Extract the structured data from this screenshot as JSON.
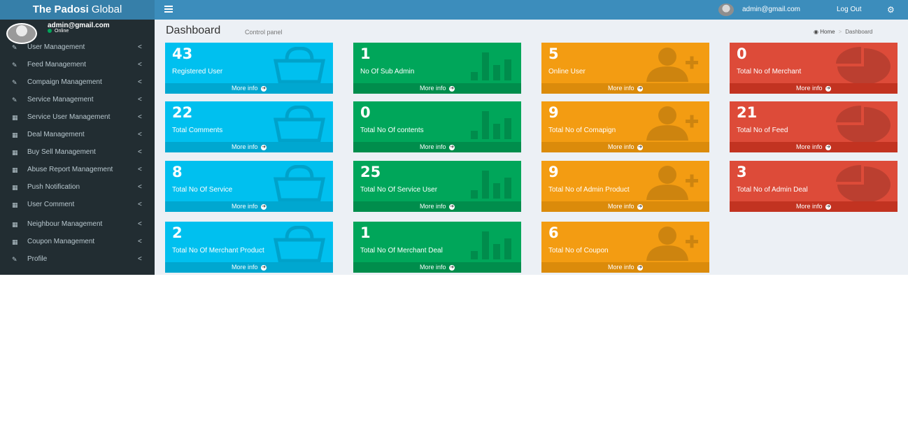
{
  "header": {
    "logo_bold": "The Padosi",
    "logo_light": " Global",
    "email": "admin@gmail.com",
    "logout": "Log Out"
  },
  "sidebar": {
    "user_email": "admin@gmail.com",
    "user_status": "Online",
    "items": [
      {
        "label": "User Management",
        "icon": "edit-icon"
      },
      {
        "label": "Feed Management",
        "icon": "edit-icon"
      },
      {
        "label": "Compaign Management",
        "icon": "edit-icon"
      },
      {
        "label": "Service Management",
        "icon": "edit-icon"
      },
      {
        "label": "Service User Management",
        "icon": "table-icon"
      },
      {
        "label": "Deal Management",
        "icon": "table-icon"
      },
      {
        "label": "Buy Sell Management",
        "icon": "table-icon"
      },
      {
        "label": "Abuse Report Management",
        "icon": "table-icon"
      },
      {
        "label": "Push Notification",
        "icon": "table-icon"
      },
      {
        "label": "User Comment",
        "icon": "table-icon"
      },
      {
        "label": "Neighbour Management",
        "icon": "table-icon"
      },
      {
        "label": "Coupon Management",
        "icon": "table-icon"
      },
      {
        "label": "Profile",
        "icon": "edit-icon"
      }
    ],
    "chevron": "<"
  },
  "content": {
    "title": "Dashboard",
    "subtitle": "Control panel",
    "breadcrumb": {
      "home": "Home",
      "sep": ">",
      "current": "Dashboard"
    }
  },
  "boxes": [
    {
      "value": "43",
      "label": "Registered User",
      "footer": "More info",
      "color": "aqua",
      "icon": "shopping-bag-icon"
    },
    {
      "value": "1",
      "label": "No Of Sub Admin",
      "footer": "More info",
      "color": "green",
      "icon": "bar-chart-icon"
    },
    {
      "value": "5",
      "label": "Online User",
      "footer": "More info",
      "color": "yellow",
      "icon": "user-add-icon"
    },
    {
      "value": "0",
      "label": "Total No of Merchant",
      "footer": "More info",
      "color": "red",
      "icon": "pie-chart-icon"
    },
    {
      "value": "22",
      "label": "Total Comments",
      "footer": "More info",
      "color": "aqua",
      "icon": "shopping-bag-icon"
    },
    {
      "value": "0",
      "label": "Total No Of contents",
      "footer": "More info",
      "color": "green",
      "icon": "bar-chart-icon"
    },
    {
      "value": "9",
      "label": "Total No of Comapign",
      "footer": "More info",
      "color": "yellow",
      "icon": "user-add-icon"
    },
    {
      "value": "21",
      "label": "Total No of Feed",
      "footer": "More info",
      "color": "red",
      "icon": "pie-chart-icon"
    },
    {
      "value": "8",
      "label": "Total No Of Service",
      "footer": "More info",
      "color": "aqua",
      "icon": "shopping-bag-icon"
    },
    {
      "value": "25",
      "label": "Total No Of Service User",
      "footer": "More info",
      "color": "green",
      "icon": "bar-chart-icon"
    },
    {
      "value": "9",
      "label": "Total No of Admin Product",
      "footer": "More info",
      "color": "yellow",
      "icon": "user-add-icon"
    },
    {
      "value": "3",
      "label": "Total No of Admin Deal",
      "footer": "More info",
      "color": "red",
      "icon": "pie-chart-icon"
    },
    {
      "value": "2",
      "label": "Total No Of Merchant Product",
      "footer": "More info",
      "color": "aqua",
      "icon": "shopping-bag-icon"
    },
    {
      "value": "1",
      "label": "Total No Of Merchant Deal",
      "footer": "More info",
      "color": "green",
      "icon": "bar-chart-icon"
    },
    {
      "value": "6",
      "label": "Total No of Coupon",
      "footer": "More info",
      "color": "yellow",
      "icon": "user-add-icon"
    }
  ],
  "colors": {
    "aqua": "#00c0ef",
    "green": "#00a65a",
    "yellow": "#f39c12",
    "red": "#dd4b39",
    "header": "#3c8dbc",
    "sidebar": "#222d32"
  }
}
